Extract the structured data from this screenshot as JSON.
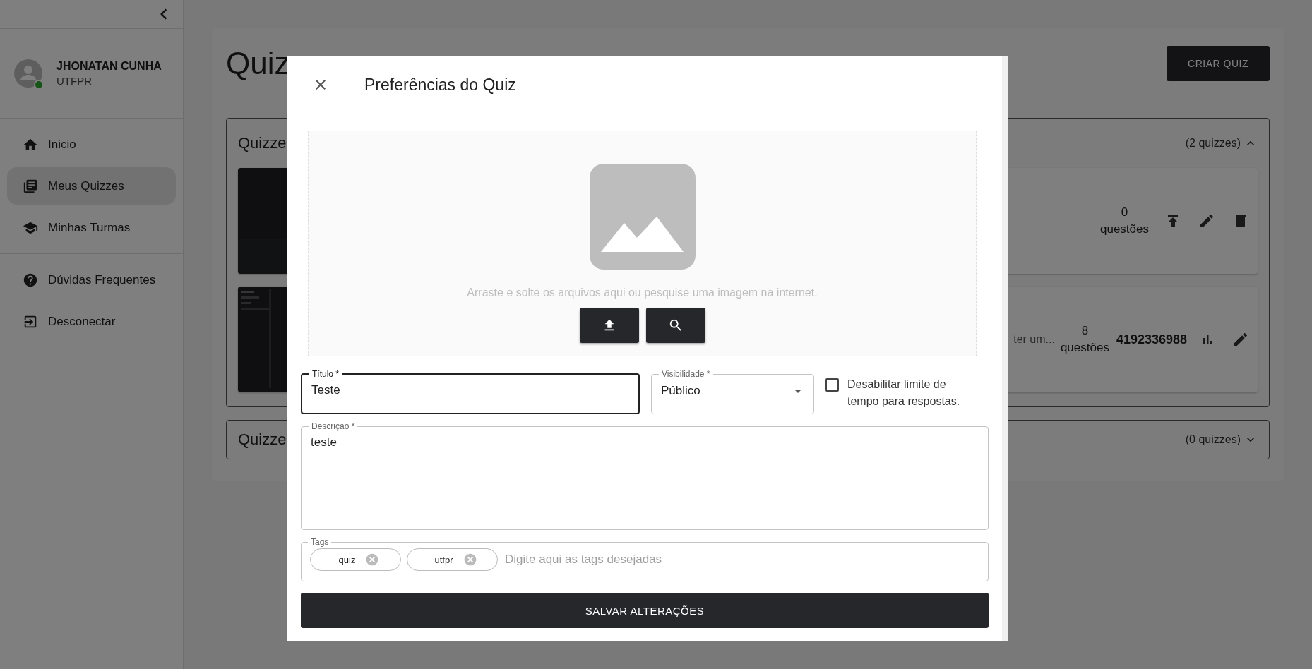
{
  "sidebar": {
    "user": {
      "name": "JHONATAN CUNHA",
      "org": "UTFPR",
      "online": true
    },
    "nav_groups": [
      [
        {
          "label": "Inicio",
          "selected": false
        },
        {
          "label": "Meus Quizzes",
          "selected": true
        },
        {
          "label": "Minhas Turmas",
          "selected": false
        }
      ],
      [
        {
          "label": "Dúvidas Frequentes",
          "selected": false
        },
        {
          "label": "Desconectar",
          "selected": false
        }
      ]
    ]
  },
  "page": {
    "title": "Quiz",
    "create_button": "CRIAR QUIZ",
    "sections": [
      {
        "title": "Quizze",
        "count": "(2 quizzes)",
        "expanded": true,
        "items": [
          {
            "questions_count": "0",
            "questions_label": "questões",
            "actions": [
              {
                "kind": "publish"
              },
              {
                "kind": "edit"
              },
              {
                "kind": "delete"
              }
            ]
          },
          {
            "description": "ter um...",
            "questions_count": "8",
            "questions_label": "questões",
            "code": "4192336988",
            "actions": [
              {
                "kind": "stats"
              },
              {
                "kind": "edit"
              }
            ]
          }
        ]
      },
      {
        "title": "Quizze",
        "count": "(0 quizzes)",
        "expanded": false
      }
    ]
  },
  "dialog": {
    "title": "Preferências do Quiz",
    "dropzone_hint": "Arraste e solte os arquivos aqui ou pesquise uma imagem na internet.",
    "title_field": {
      "label": "Título *",
      "value": "Teste",
      "focused": true
    },
    "visibility_field": {
      "label": "Visibilidade *",
      "value": "Público"
    },
    "time_limit": {
      "label": "Desabilitar limite de tempo para respostas.",
      "checked": false
    },
    "description_field": {
      "label": "Descrição *",
      "value": "teste"
    },
    "tags_field": {
      "label": "Tags",
      "tags": [
        "quiz",
        "utfpr"
      ],
      "placeholder": "Digite aqui as tags desejadas"
    },
    "save_button": "SALVAR ALTERAÇÕES"
  }
}
